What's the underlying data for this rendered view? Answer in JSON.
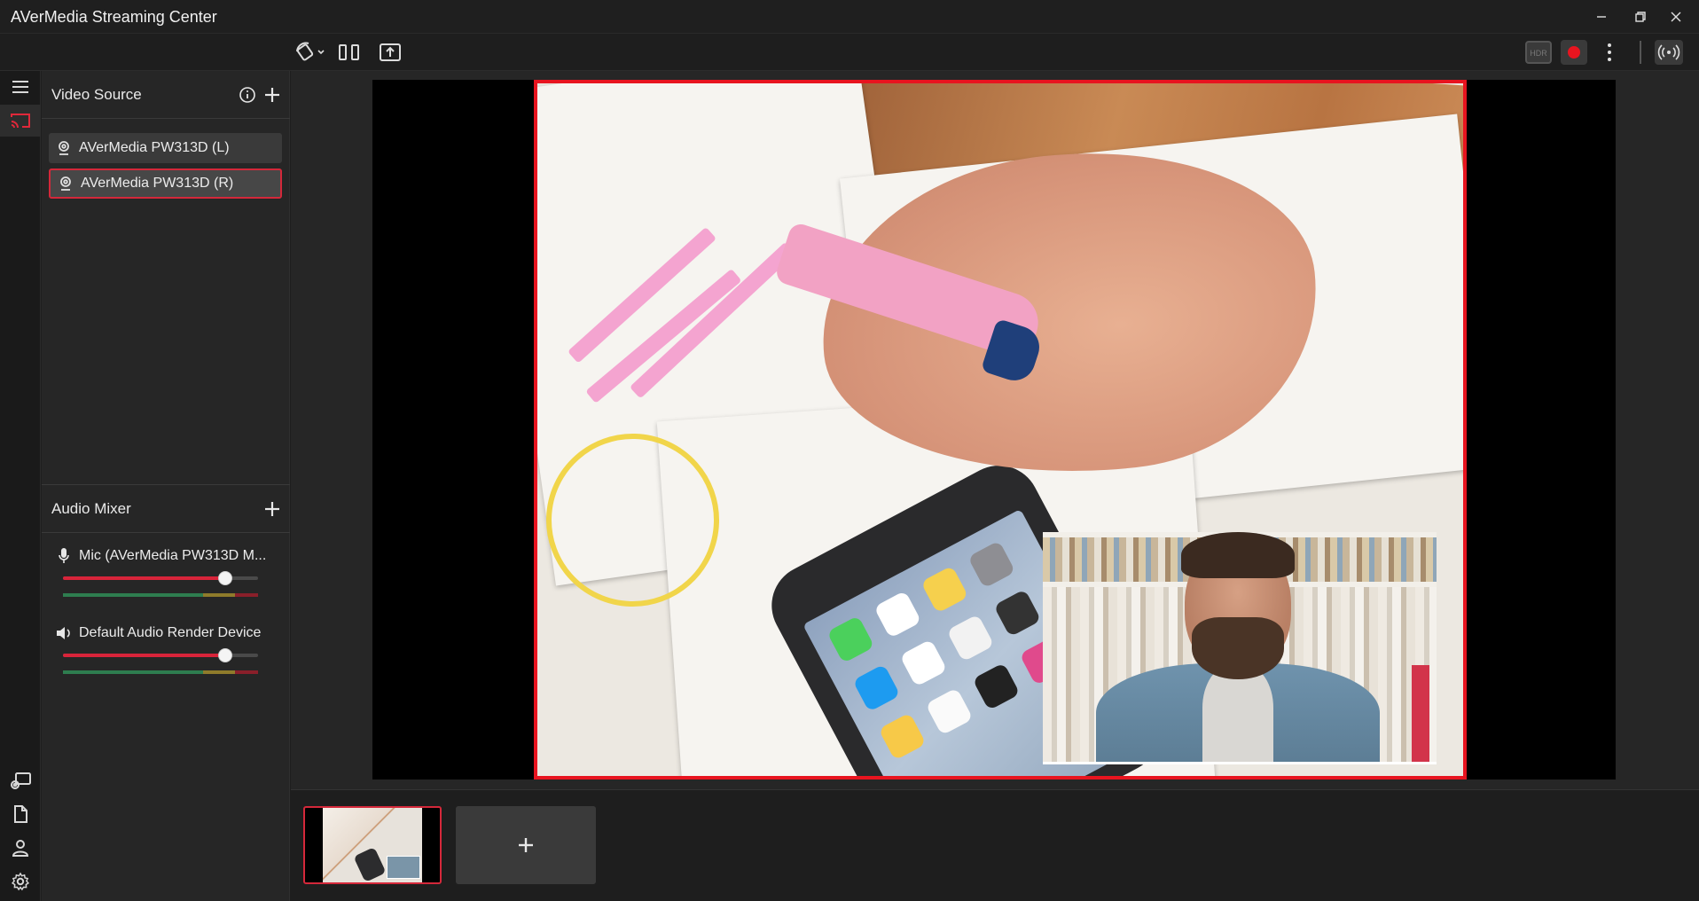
{
  "window": {
    "title": "AVerMedia Streaming Center"
  },
  "video_source": {
    "title": "Video Source",
    "items": [
      {
        "label": "AVerMedia PW313D (L)",
        "selected": false
      },
      {
        "label": "AVerMedia PW313D (R)",
        "selected": true
      }
    ]
  },
  "audio_mixer": {
    "title": "Audio Mixer",
    "channels": [
      {
        "label": "Mic (AVerMedia PW313D M...",
        "icon": "microphone-icon",
        "volume": 0.86
      },
      {
        "label": "Default Audio Render Device",
        "icon": "speaker-icon",
        "volume": 0.86
      }
    ]
  },
  "scenes": {
    "add_label": "+"
  },
  "colors": {
    "accent": "#e8141f",
    "panel": "#262626",
    "background": "#1e1e1e"
  }
}
